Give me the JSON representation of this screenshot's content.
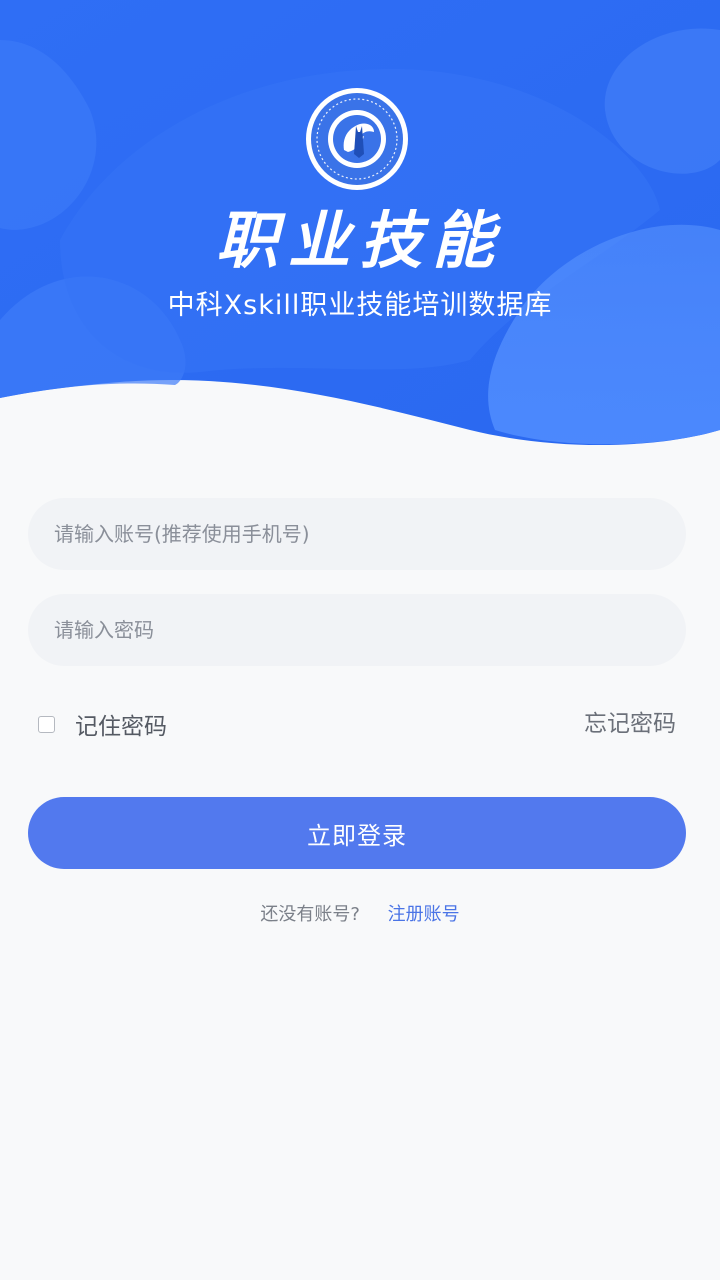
{
  "header": {
    "title": "职业技能",
    "subtitle": "中科Xskill职业技能培训数据库",
    "logo_icon": "xskill-emblem-logo"
  },
  "form": {
    "account_placeholder": "请输入账号(推荐使用手机号)",
    "password_placeholder": "请输入密码",
    "remember_label": "记住密码",
    "remember_checked": false,
    "forgot_label": "忘记密码",
    "login_label": "立即登录",
    "register_prompt": "还没有账号?",
    "register_link": "注册账号"
  },
  "colors": {
    "header_blue": "#2f6ef5",
    "primary_button": "#5279ee",
    "link": "#4a74e6",
    "background": "#f8f9fa",
    "input_background": "#f1f3f6"
  }
}
